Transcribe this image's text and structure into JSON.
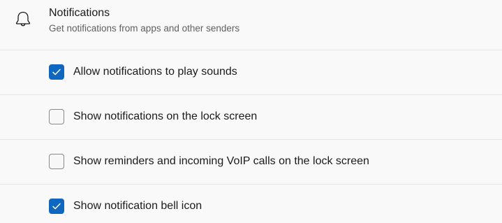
{
  "section": {
    "icon": "bell-icon",
    "title": "Notifications",
    "subtitle": "Get notifications from apps and other senders"
  },
  "options": [
    {
      "label": "Allow notifications to play sounds",
      "checked": true
    },
    {
      "label": "Show notifications on the lock screen",
      "checked": false
    },
    {
      "label": "Show reminders and incoming VoIP calls on the lock screen",
      "checked": false
    },
    {
      "label": "Show notification bell icon",
      "checked": true
    }
  ],
  "colors": {
    "accent": "#0f67c0",
    "background": "#f9f9f9",
    "divider": "#e5e5e5"
  }
}
